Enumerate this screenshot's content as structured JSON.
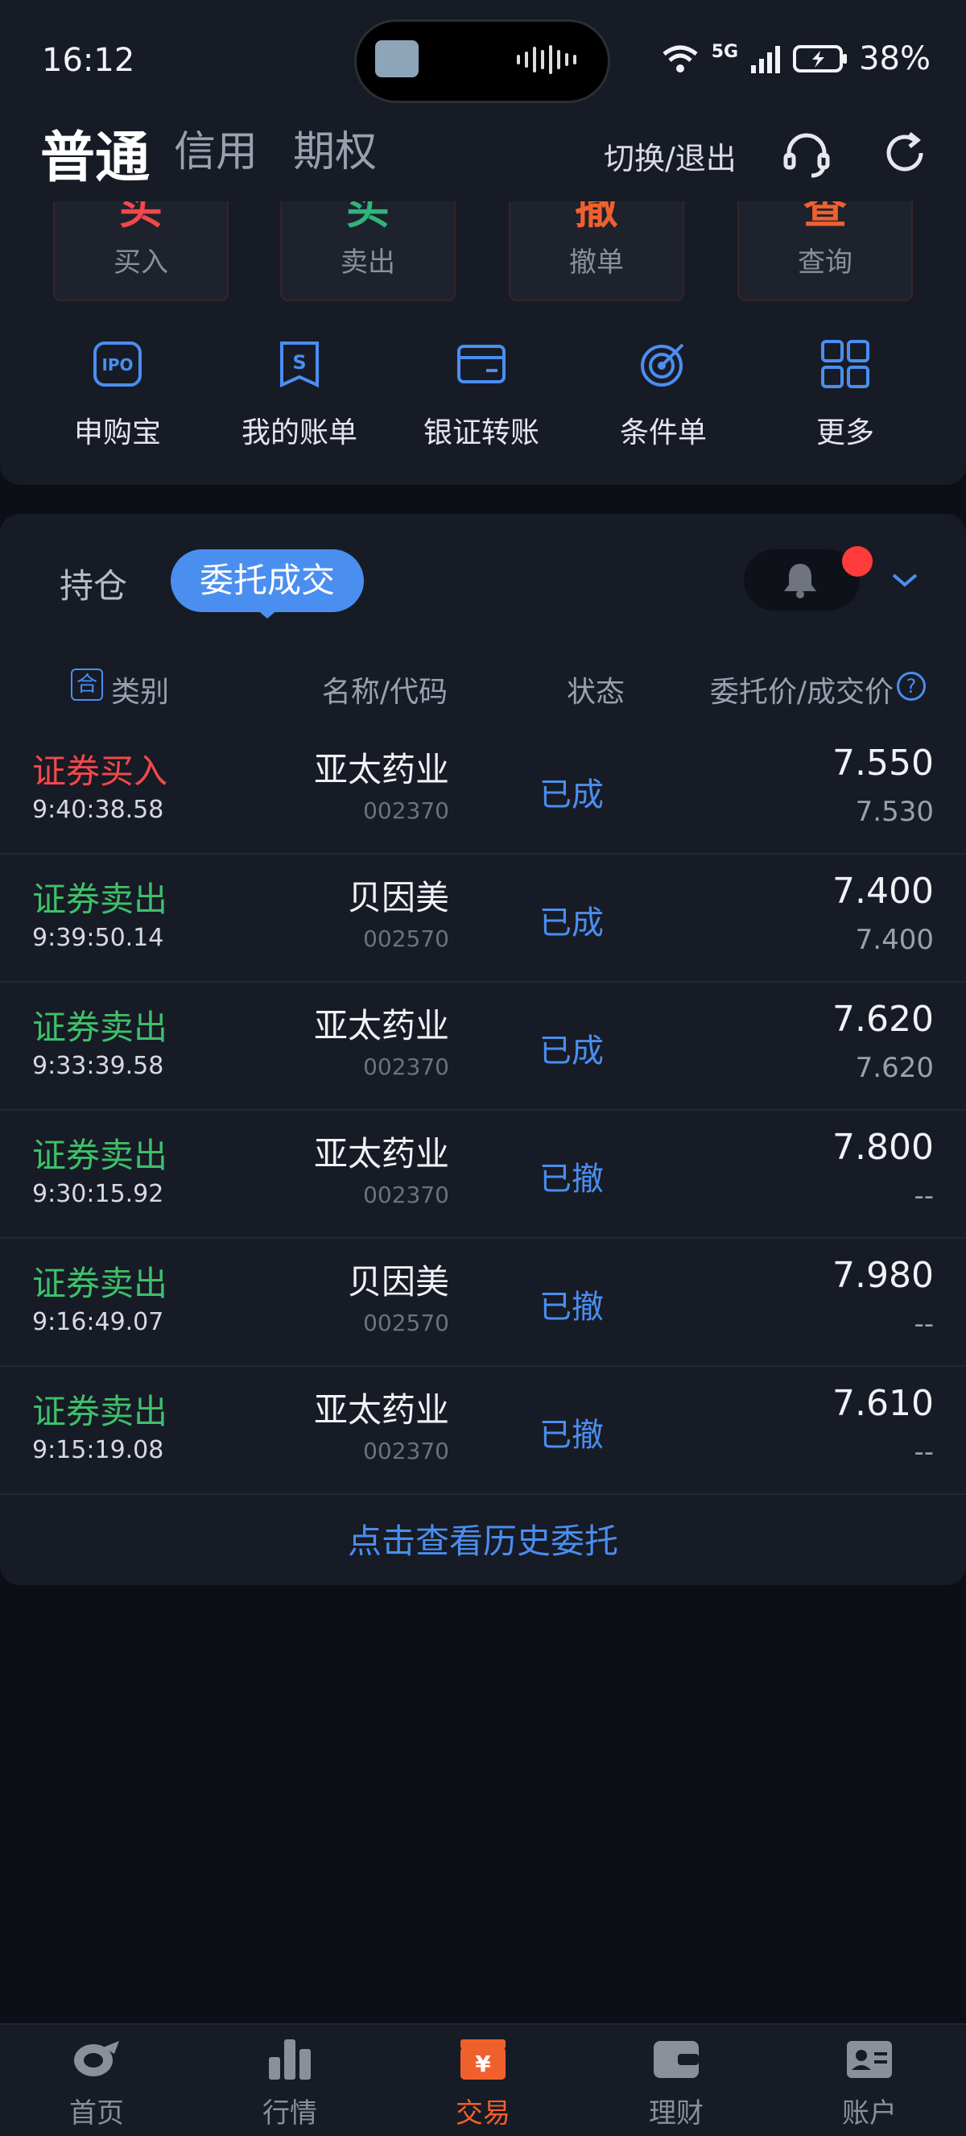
{
  "status_bar": {
    "time": "16:12",
    "network": "5G",
    "battery": "38%"
  },
  "header": {
    "tabs": [
      "普通",
      "信用",
      "期权"
    ],
    "switch_exit": "切换/退出"
  },
  "trade_actions": [
    {
      "glyph": "买",
      "label": "买入",
      "color": "#f2484a"
    },
    {
      "glyph": "买",
      "label": "卖出",
      "color": "#2fb57a"
    },
    {
      "glyph": "撤",
      "label": "撤单",
      "color": "#f0602d"
    },
    {
      "glyph": "查",
      "label": "查询",
      "color": "#f0602d"
    }
  ],
  "quick_actions": [
    {
      "label": "申购宝",
      "icon": "ipo-icon"
    },
    {
      "label": "我的账单",
      "icon": "bill-icon"
    },
    {
      "label": "银证转账",
      "icon": "transfer-card-icon"
    },
    {
      "label": "条件单",
      "icon": "target-icon"
    },
    {
      "label": "更多",
      "icon": "grid-icon"
    }
  ],
  "list": {
    "tabs": {
      "positions": "持仓",
      "orders": "委托成交"
    },
    "columns": {
      "badge": "合",
      "type": "类别",
      "name": "名称/代码",
      "status": "状态",
      "price": "委托价/成交价",
      "help": "?"
    },
    "rows": [
      {
        "type": "证券买入",
        "side": "buy",
        "time": "9:40:38.58",
        "name": "亚太药业",
        "code": "002370",
        "status": "已成",
        "order_price": "7.550",
        "deal_price": "7.530"
      },
      {
        "type": "证券卖出",
        "side": "sell",
        "time": "9:39:50.14",
        "name": "贝因美",
        "code": "002570",
        "status": "已成",
        "order_price": "7.400",
        "deal_price": "7.400"
      },
      {
        "type": "证券卖出",
        "side": "sell",
        "time": "9:33:39.58",
        "name": "亚太药业",
        "code": "002370",
        "status": "已成",
        "order_price": "7.620",
        "deal_price": "7.620"
      },
      {
        "type": "证券卖出",
        "side": "sell",
        "time": "9:30:15.92",
        "name": "亚太药业",
        "code": "002370",
        "status": "已撤",
        "order_price": "7.800",
        "deal_price": "--"
      },
      {
        "type": "证券卖出",
        "side": "sell",
        "time": "9:16:49.07",
        "name": "贝因美",
        "code": "002570",
        "status": "已撤",
        "order_price": "7.980",
        "deal_price": "--"
      },
      {
        "type": "证券卖出",
        "side": "sell",
        "time": "9:15:19.08",
        "name": "亚太药业",
        "code": "002370",
        "status": "已撤",
        "order_price": "7.610",
        "deal_price": "--"
      }
    ],
    "history_link": "点击查看历史委托"
  },
  "bottom_nav": [
    {
      "label": "首页",
      "icon": "home-icon",
      "active": false
    },
    {
      "label": "行情",
      "icon": "market-icon",
      "active": false
    },
    {
      "label": "交易",
      "icon": "trade-icon",
      "active": true,
      "glyph": "¥"
    },
    {
      "label": "理财",
      "icon": "wallet-icon",
      "active": false
    },
    {
      "label": "账户",
      "icon": "account-icon",
      "active": false
    }
  ],
  "colors": {
    "accent_blue": "#4a8ef0",
    "buy_red": "#f2484a",
    "sell_green": "#3fbf6a",
    "active_orange": "#f0602d"
  }
}
